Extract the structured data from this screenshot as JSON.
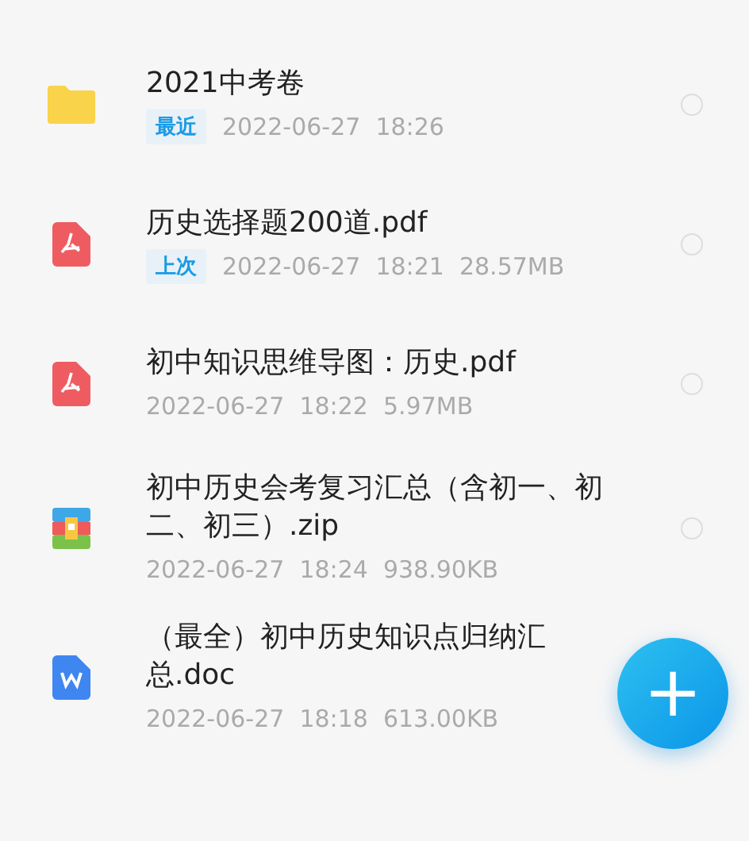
{
  "files": [
    {
      "kind": "folder",
      "title_lines": [
        "2021中考卷"
      ],
      "badge": "最近",
      "meta": "2022-06-27  18:26",
      "selected": false
    },
    {
      "kind": "pdf",
      "title_lines": [
        "历史选择题200道.pdf"
      ],
      "badge": "上次",
      "meta": "2022-06-27  18:21  28.57MB",
      "selected": false
    },
    {
      "kind": "pdf",
      "title_lines": [
        "初中知识思维导图：历史.pdf"
      ],
      "meta": "2022-06-27  18:22  5.97MB",
      "selected": false
    },
    {
      "kind": "zip",
      "title_lines": [
        "初中历史会考复习汇总（含初一、初",
        "二、初三）.zip"
      ],
      "meta": "2022-06-27  18:24  938.90KB",
      "selected": false
    },
    {
      "kind": "doc",
      "title_lines": [
        "（最全）初中历史知识点归纳汇",
        "总.doc"
      ],
      "meta": "2022-06-27  18:18  613.00KB"
    }
  ],
  "fab": {
    "label": "+"
  }
}
